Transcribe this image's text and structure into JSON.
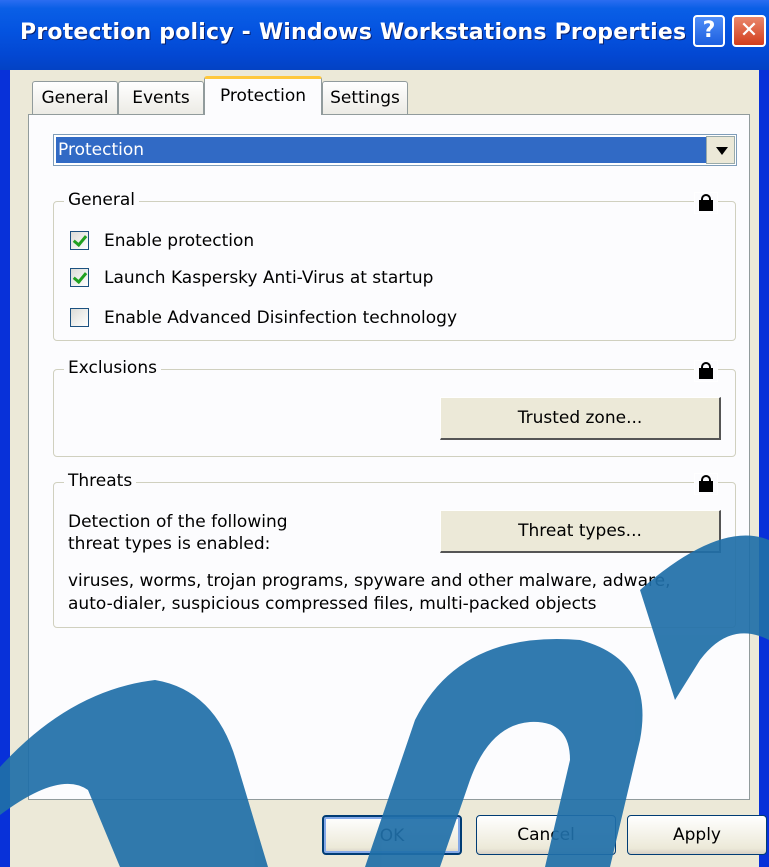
{
  "window": {
    "title": "Protection policy - Windows Workstations Properties",
    "help_glyph": "?",
    "close_glyph": "✕"
  },
  "tabs": [
    {
      "label": "General",
      "active": false
    },
    {
      "label": "Events",
      "active": false
    },
    {
      "label": "Protection",
      "active": true
    },
    {
      "label": "Settings",
      "active": false
    }
  ],
  "section_dropdown": {
    "selected": "Protection"
  },
  "general_group": {
    "title": "General",
    "options": [
      {
        "label": "Enable protection",
        "checked": true
      },
      {
        "label": "Launch Kaspersky Anti-Virus at startup",
        "checked": true
      },
      {
        "label": "Enable Advanced Disinfection technology",
        "checked": false
      }
    ]
  },
  "exclusions_group": {
    "title": "Exclusions",
    "button_label": "Trusted zone..."
  },
  "threats_group": {
    "title": "Threats",
    "description_line1": "Detection of the following",
    "description_line2": "threat types is enabled:",
    "button_label": "Threat types...",
    "list_line1": "viruses, worms, trojan programs, spyware and other malware, adware,",
    "list_line2": "auto-dialer, suspicious compressed files, multi-packed objects"
  },
  "footer": {
    "ok_label": "OK",
    "cancel_label": "Cancel",
    "apply_label": "Apply"
  },
  "colors": {
    "titlebar": "#0453e0",
    "dialog_face": "#ece9d8",
    "selection": "#316ac5",
    "watermark": "#1f6fa8"
  }
}
